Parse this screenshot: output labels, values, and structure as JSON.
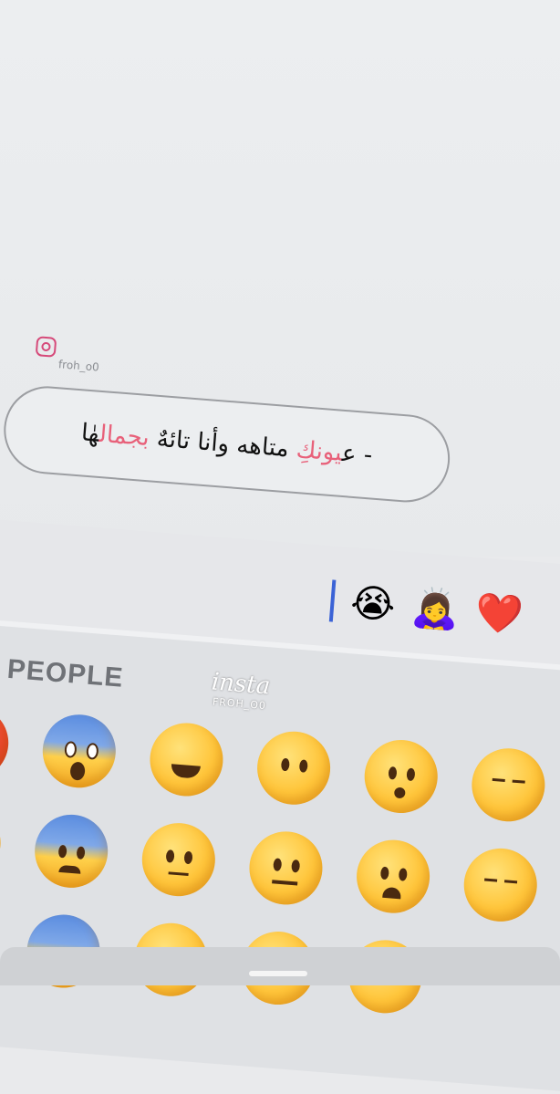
{
  "watermark_top": {
    "handle": "froh_o0"
  },
  "message": {
    "segments": [
      {
        "text": "- ع",
        "highlight": false
      },
      {
        "text": "يونكِ",
        "highlight": true
      },
      {
        "text": " متاهه وأنا تائهٌ ",
        "highlight": false
      },
      {
        "text": "بجمال",
        "highlight": true
      },
      {
        "text": "هٰا",
        "highlight": false
      }
    ]
  },
  "input": {
    "emojis": [
      "😭",
      "🙇‍♀️",
      "❤️"
    ]
  },
  "keyboard": {
    "section_title": "S & PEOPLE",
    "watermark": {
      "script": "insta",
      "handle": "FROH_O0"
    }
  },
  "colors": {
    "highlight": "#e8617a",
    "cursor": "#3b63d6"
  }
}
